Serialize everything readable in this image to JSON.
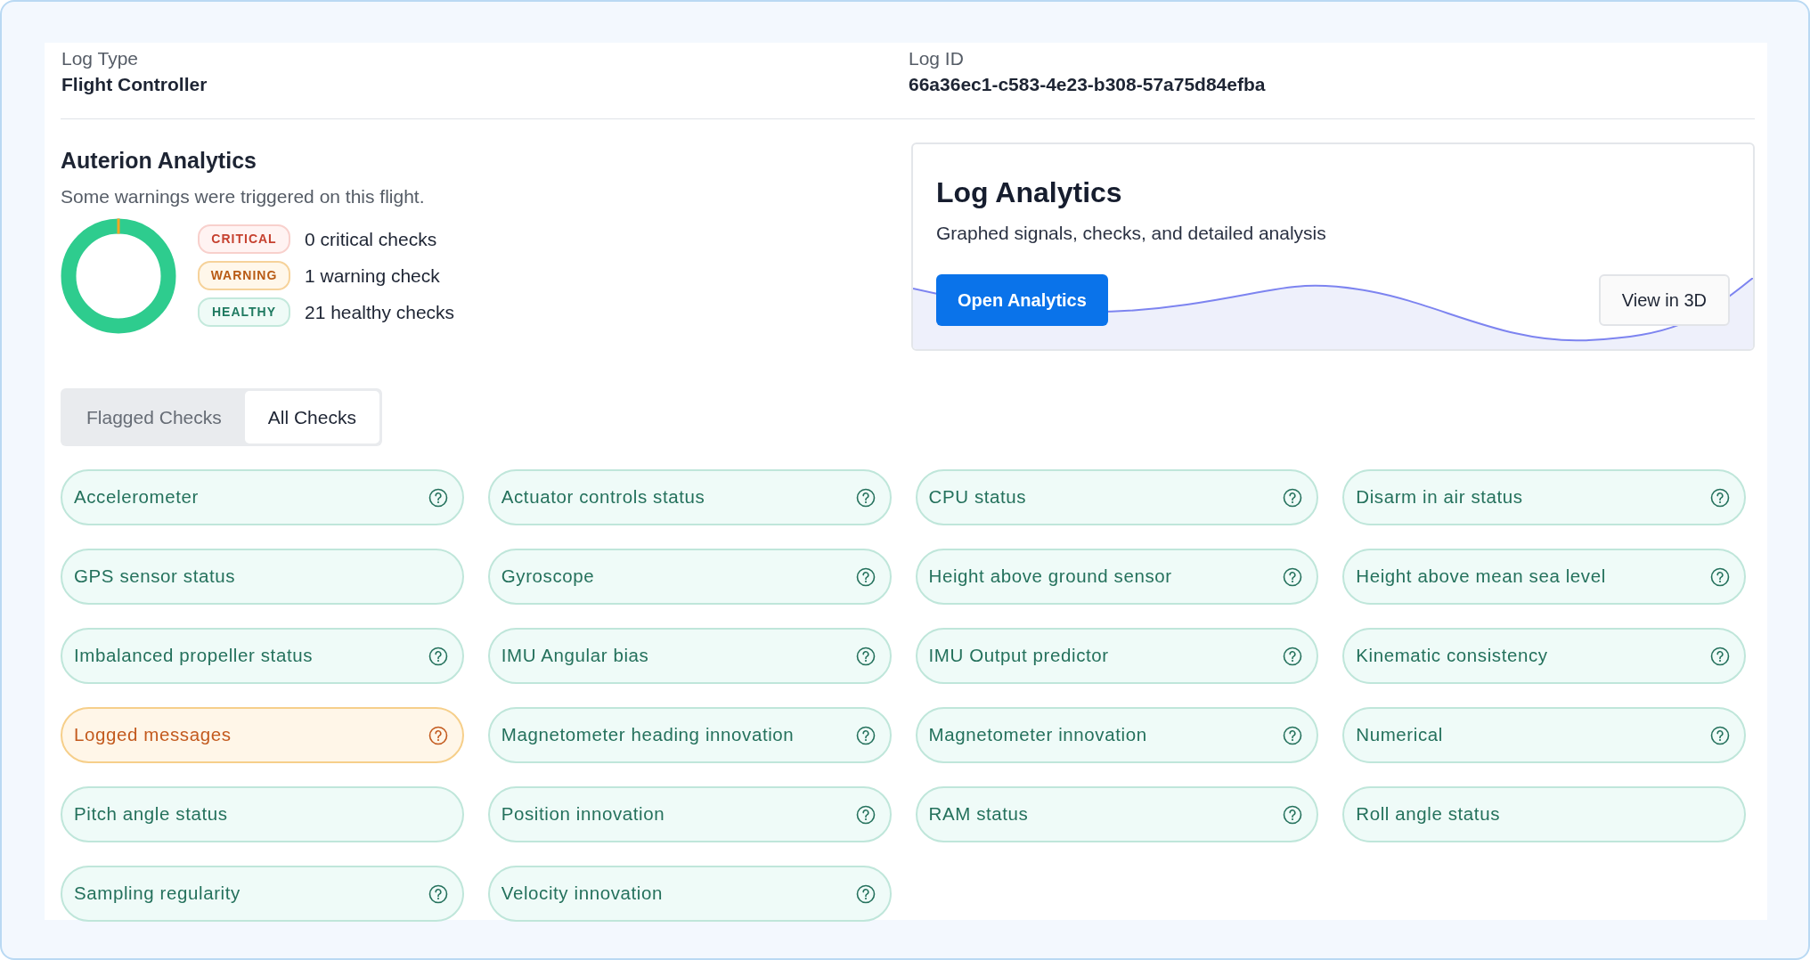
{
  "log_info": [
    {
      "label": "Log Type",
      "value": "Flight Controller"
    },
    {
      "label": "Log ID",
      "value": "66a36ec1-c583-4e23-b308-57a75d84efba"
    }
  ],
  "analytics": {
    "title": "Auterion Analytics",
    "subtitle": "Some warnings were triggered on this flight.",
    "summary": [
      {
        "kind": "critical",
        "badge": "CRITICAL",
        "text": "0 critical checks"
      },
      {
        "kind": "warning",
        "badge": "WARNING",
        "text": "1 warning check"
      },
      {
        "kind": "healthy",
        "badge": "HEALTHY",
        "text": "21 healthy checks"
      }
    ]
  },
  "log_analytics_card": {
    "title": "Log Analytics",
    "subtitle": "Graphed signals, checks, and detailed analysis",
    "primary_button": "Open Analytics",
    "secondary_button": "View in 3D"
  },
  "tabs": [
    {
      "label": "Flagged Checks",
      "selected": false
    },
    {
      "label": "All Checks",
      "selected": true
    }
  ],
  "checks": [
    {
      "label": "Accelerometer",
      "kind": "healthy",
      "help": true
    },
    {
      "label": "Actuator controls status",
      "kind": "healthy",
      "help": true
    },
    {
      "label": "CPU status",
      "kind": "healthy",
      "help": true
    },
    {
      "label": "Disarm in air status",
      "kind": "healthy",
      "help": true
    },
    {
      "label": "GPS sensor status",
      "kind": "healthy",
      "help": false
    },
    {
      "label": "Gyroscope",
      "kind": "healthy",
      "help": true
    },
    {
      "label": "Height above ground sensor",
      "kind": "healthy",
      "help": true
    },
    {
      "label": "Height above mean sea level",
      "kind": "healthy",
      "help": true
    },
    {
      "label": "Imbalanced propeller status",
      "kind": "healthy",
      "help": true
    },
    {
      "label": "IMU Angular bias",
      "kind": "healthy",
      "help": true
    },
    {
      "label": "IMU Output predictor",
      "kind": "healthy",
      "help": true
    },
    {
      "label": "Kinematic consistency",
      "kind": "healthy",
      "help": true
    },
    {
      "label": "Logged messages",
      "kind": "warning",
      "help": true
    },
    {
      "label": "Magnetometer heading innovation",
      "kind": "healthy",
      "help": true
    },
    {
      "label": "Magnetometer innovation",
      "kind": "healthy",
      "help": true
    },
    {
      "label": "Numerical",
      "kind": "healthy",
      "help": true
    },
    {
      "label": "Pitch angle status",
      "kind": "healthy",
      "help": false
    },
    {
      "label": "Position innovation",
      "kind": "healthy",
      "help": true
    },
    {
      "label": "RAM status",
      "kind": "healthy",
      "help": true
    },
    {
      "label": "Roll angle status",
      "kind": "healthy",
      "help": false
    },
    {
      "label": "Sampling regularity",
      "kind": "healthy",
      "help": true
    },
    {
      "label": "Velocity innovation",
      "kind": "healthy",
      "help": true
    }
  ]
}
